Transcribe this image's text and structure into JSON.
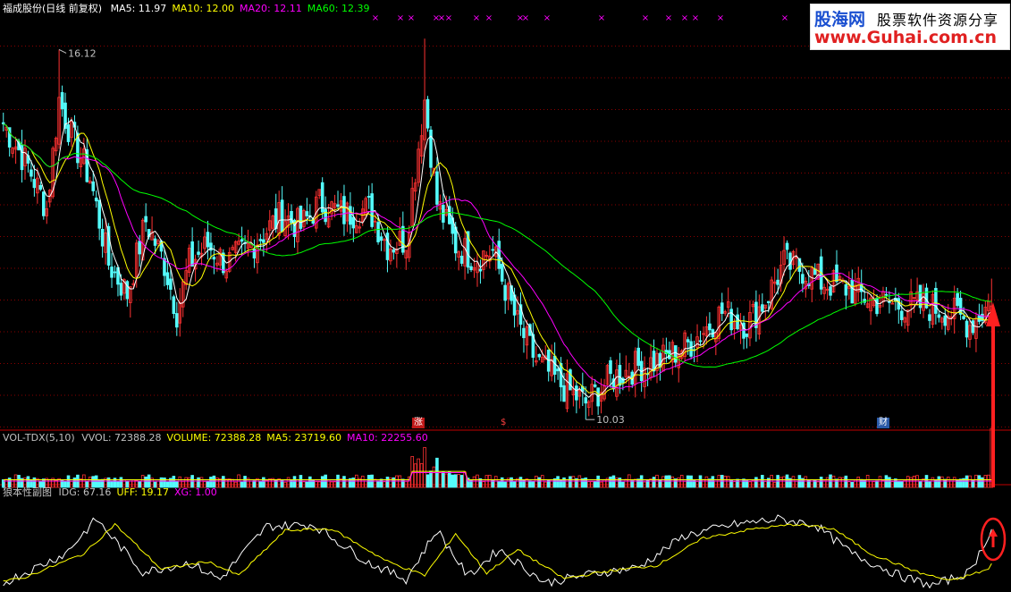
{
  "price_panel": {
    "stock_name": "福成股份",
    "period_label": "(日线 前复权)",
    "ma_labels": [
      {
        "name": "MA5",
        "value": "11.97",
        "color": "#ffffff"
      },
      {
        "name": "MA10",
        "value": "12.00",
        "color": "#ffff00"
      },
      {
        "name": "MA20",
        "value": "12.11",
        "color": "#ff00ff"
      },
      {
        "name": "MA60",
        "value": "12.39",
        "color": "#00ff00"
      }
    ],
    "high_label": "16.12",
    "low_label": "10.03",
    "event_marks": [
      {
        "text": "涨",
        "bg": "#c01818",
        "color": "#ffffff"
      },
      {
        "text": "$",
        "bg": "#000000",
        "color": "#ff4040"
      },
      {
        "text": "财",
        "bg": "#2a5aa8",
        "color": "#ffffff"
      }
    ],
    "top_marker_glyph": "×"
  },
  "volume_panel": {
    "indicator": "VOL-TDX(5,10)",
    "labels": [
      {
        "name": "VVOL",
        "value": "72388.28",
        "color": "#c0c0c0"
      },
      {
        "name": "VOLUME",
        "value": "72388.28",
        "color": "#ffff00"
      },
      {
        "name": "MA5",
        "value": "23719.60",
        "color": "#ffff00"
      },
      {
        "name": "MA10",
        "value": "22255.60",
        "color": "#ff00ff"
      }
    ]
  },
  "sub_panel": {
    "title": "狼本性副图",
    "labels": [
      {
        "name": "IDG",
        "value": "67.16",
        "color": "#c0c0c0"
      },
      {
        "name": "UFF",
        "value": "19.17",
        "color": "#ffff00"
      },
      {
        "name": "XG",
        "value": "1.00",
        "color": "#ff00ff"
      }
    ]
  },
  "logo": {
    "line1": "股海网",
    "line2": "股票软件资源分享",
    "line3": "www.Guhai.com.cn"
  },
  "colors": {
    "up": "#ff3232",
    "down": "#54fcfc",
    "ma5": "#ffffff",
    "ma10": "#ffff00",
    "ma20": "#ff00ff",
    "ma60": "#00ff00",
    "grid": "#8b0000",
    "arrow": "#ff2020"
  },
  "chart_data": {
    "type": "candlestick",
    "y_range": [
      9.9,
      16.7
    ],
    "n_bars": 320,
    "anchors": [
      [
        0,
        14.9
      ],
      [
        8,
        14.2
      ],
      [
        14,
        13.5
      ],
      [
        18,
        15.3
      ],
      [
        22,
        14.7
      ],
      [
        28,
        14.0
      ],
      [
        34,
        12.6
      ],
      [
        40,
        12.1
      ],
      [
        46,
        13.3
      ],
      [
        52,
        12.6
      ],
      [
        56,
        11.8
      ],
      [
        60,
        12.6
      ],
      [
        66,
        12.9
      ],
      [
        72,
        12.6
      ],
      [
        78,
        12.8
      ],
      [
        84,
        13.1
      ],
      [
        90,
        13.4
      ],
      [
        96,
        13.2
      ],
      [
        102,
        13.6
      ],
      [
        110,
        13.4
      ],
      [
        118,
        13.5
      ],
      [
        124,
        12.9
      ],
      [
        130,
        13.0
      ],
      [
        136,
        15.3
      ],
      [
        140,
        13.6
      ],
      [
        146,
        12.9
      ],
      [
        152,
        12.7
      ],
      [
        158,
        12.8
      ],
      [
        166,
        11.6
      ],
      [
        172,
        11.0
      ],
      [
        180,
        10.6
      ],
      [
        188,
        10.3
      ],
      [
        196,
        10.7
      ],
      [
        204,
        10.9
      ],
      [
        212,
        11.0
      ],
      [
        222,
        11.3
      ],
      [
        232,
        11.8
      ],
      [
        240,
        11.6
      ],
      [
        246,
        12.0
      ],
      [
        252,
        12.6
      ],
      [
        258,
        12.5
      ],
      [
        264,
        12.3
      ],
      [
        272,
        12.2
      ],
      [
        280,
        12.0
      ],
      [
        290,
        11.9
      ],
      [
        298,
        11.9
      ],
      [
        306,
        11.8
      ],
      [
        312,
        11.6
      ],
      [
        316,
        11.8
      ],
      [
        319,
        12.0
      ]
    ],
    "last_bar": {
      "open": 11.6,
      "close": 11.9,
      "high": 12.35,
      "low": 11.55
    }
  }
}
